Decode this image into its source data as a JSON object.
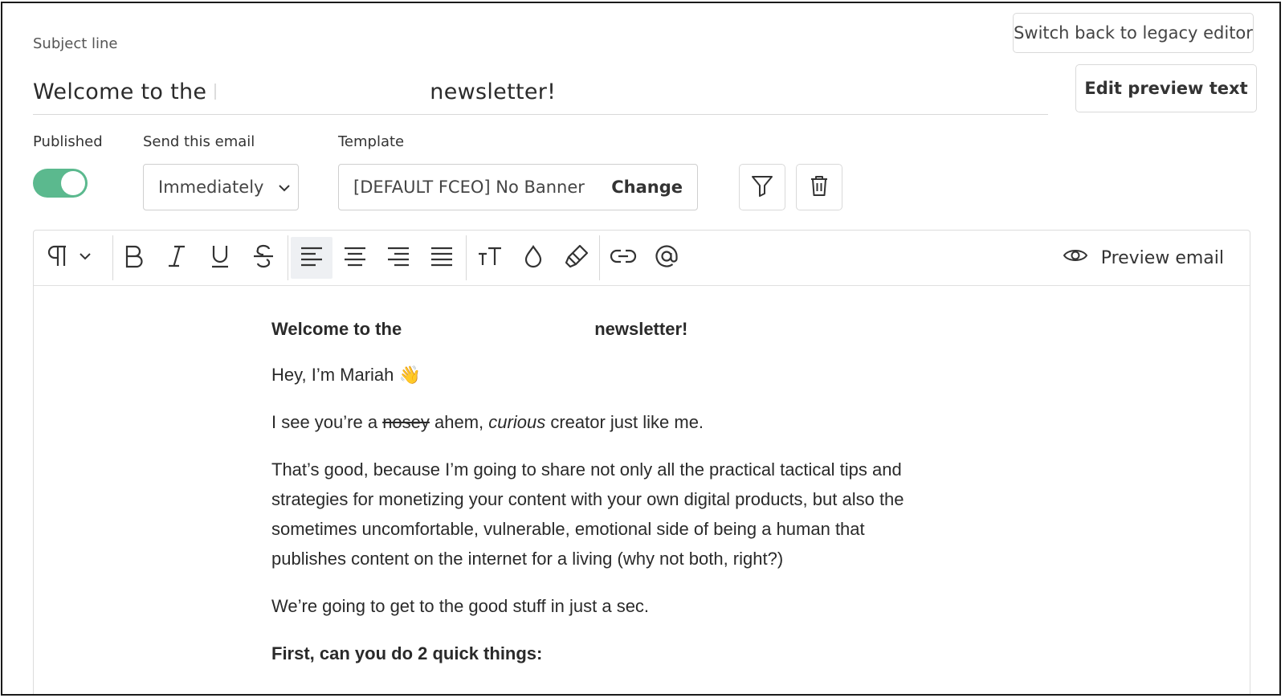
{
  "header": {
    "subject_label": "Subject line",
    "subject_before": "Welcome to the",
    "subject_after": "newsletter!",
    "legacy_button": "Switch back to legacy editor",
    "preview_text_button": "Edit preview text"
  },
  "settings": {
    "published_label": "Published",
    "published": true,
    "send_label": "Send this email",
    "send_value": "Immediately",
    "template_label": "Template",
    "template_value": "[DEFAULT FCEO] No Banner",
    "template_change": "Change"
  },
  "colors": {
    "toggle_on": "#5bb98e",
    "active_tool_bg": "#eef0f3"
  },
  "toolbar": {
    "tools": [
      "paragraph-icon",
      "bold-icon",
      "italic-icon",
      "underline-icon",
      "strikethrough-icon",
      "align-left-icon",
      "align-center-icon",
      "align-right-icon",
      "align-justify-icon",
      "font-size-icon",
      "text-color-icon",
      "highlight-icon",
      "link-icon",
      "mention-icon"
    ],
    "active_tool": "align-left-icon",
    "preview_label": "Preview email"
  },
  "body": {
    "heading_before": "Welcome to the",
    "heading_after": "newsletter!",
    "greeting": "Hey, I’m Mariah 👋",
    "line2_a": "I see you’re a ",
    "line2_strike": "nosey",
    "line2_b": " ahem, ",
    "line2_italic": "curious",
    "line2_c": " creator just like me.",
    "para3_l1": "That’s good, because I’m going to share not only all the practical tactical tips and",
    "para3_l2": "strategies for monetizing your content with your own digital products, but also the",
    "para3_l3": "sometimes uncomfortable, vulnerable, emotional side of being a human that",
    "para3_l4": "publishes content on the internet for a living (why not both, right?)",
    "line4": "We’re going to get to the good stuff in just a sec.",
    "subheading": "First, can you do 2 quick things:"
  }
}
